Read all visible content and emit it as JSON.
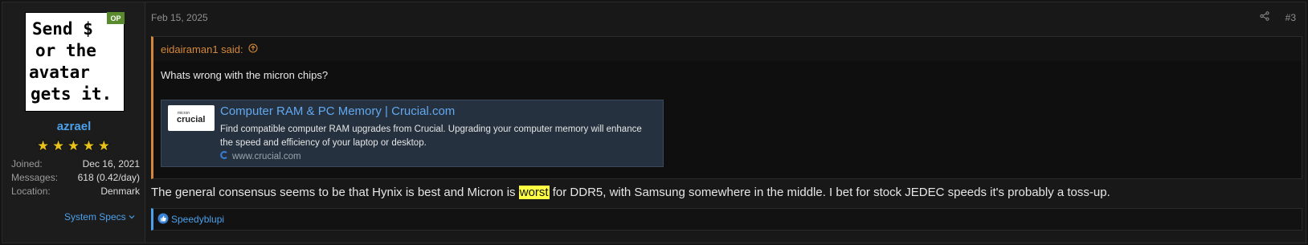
{
  "user": {
    "avatar_lines": [
      "Send $",
      "or the",
      "avatar",
      "gets it."
    ],
    "op_badge": "OP",
    "username": "azrael",
    "stars": "★★★★★",
    "joined_label": "Joined:",
    "joined_value": "Dec 16, 2021",
    "messages_label": "Messages:",
    "messages_value": "618 (0.42/day)",
    "location_label": "Location:",
    "location_value": "Denmark",
    "specs_label": "System Specs"
  },
  "post": {
    "date": "Feb 15, 2025",
    "number": "#3",
    "quote": {
      "author": "eidairaman1 said:",
      "text": "Whats wrong with the micron chips?",
      "unfurl": {
        "logo_small": "micron",
        "logo_big": "crucial",
        "title": "Computer RAM & PC Memory | Crucial.com",
        "description": "Find compatible computer RAM upgrades from Crucial. Upgrading your computer memory will enhance the speed and efficiency of your laptop or desktop.",
        "domain": "www.crucial.com"
      }
    },
    "body_before": "The general consensus seems to be that Hynix is best and Micron is ",
    "body_highlight": "worst",
    "body_after": " for DDR5, with Samsung somewhere in the middle. I bet for stock JEDEC speeds it's probably a toss-up.",
    "reaction_user": "Speedyblupi"
  },
  "colors": {
    "link": "#4ba0ea",
    "quote_accent": "#d4873a",
    "highlight": "#ffff44",
    "op_badge": "#5a8a2e",
    "stars": "#e8c21a"
  }
}
